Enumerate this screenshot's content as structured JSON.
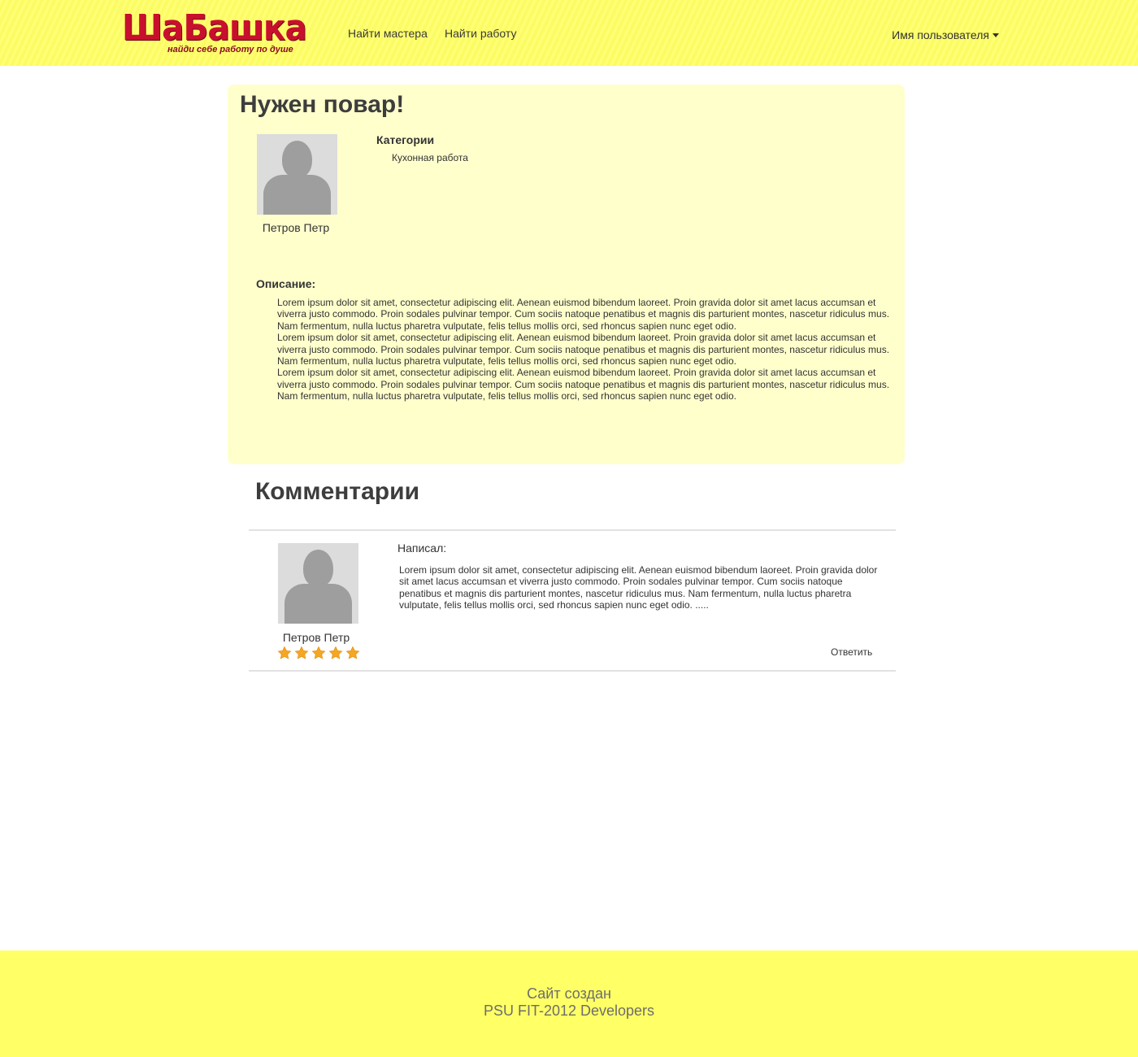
{
  "header": {
    "logo_text": "ШаБашка",
    "logo_tagline": "найди себе работу по душе",
    "nav": [
      {
        "label": "Найти мастера"
      },
      {
        "label": "Найти работу"
      }
    ],
    "user_menu_label": "Имя пользователя"
  },
  "job": {
    "title": "Нужен повар!",
    "author": "Петров Петр",
    "categories_title": "Категории",
    "categories": [
      "Кухонная работа"
    ],
    "description_title": "Описание:",
    "description_paragraphs": [
      "Lorem ipsum dolor sit amet, consectetur adipiscing elit. Aenean euismod bibendum laoreet. Proin gravida dolor sit amet lacus accumsan et viverra justo commodo. Proin sodales pulvinar tempor. Cum sociis natoque penatibus et magnis dis parturient montes, nascetur ridiculus mus. Nam fermentum, nulla luctus pharetra vulputate, felis tellus mollis orci, sed rhoncus sapien nunc eget odio.",
      "Lorem ipsum dolor sit amet, consectetur adipiscing elit. Aenean euismod bibendum laoreet. Proin gravida dolor sit amet lacus accumsan et viverra justo commodo. Proin sodales pulvinar tempor. Cum sociis natoque penatibus et magnis dis parturient montes, nascetur ridiculus mus. Nam fermentum, nulla luctus pharetra vulputate, felis tellus mollis orci, sed rhoncus sapien nunc eget odio.",
      "Lorem ipsum dolor sit amet, consectetur adipiscing elit. Aenean euismod bibendum laoreet. Proin gravida dolor sit amet lacus accumsan et viverra justo commodo. Proin sodales pulvinar tempor. Cum sociis natoque penatibus et magnis dis parturient montes, nascetur ridiculus mus. Nam fermentum, nulla luctus pharetra vulputate, felis tellus mollis orci, sed rhoncus sapien nunc eget odio."
    ]
  },
  "comments": {
    "title": "Комментарии",
    "items": [
      {
        "wrote_label": "Написал:",
        "author": "Петров Петр",
        "rating": 5,
        "rating_max": 5,
        "text": "Lorem ipsum dolor sit amet, consectetur adipiscing elit. Aenean euismod bibendum laoreet. Proin gravida dolor sit amet lacus accumsan et viverra justo commodo. Proin sodales pulvinar tempor. Cum sociis natoque penatibus et magnis dis parturient montes, nascetur ridiculus mus. Nam fermentum, nulla luctus pharetra vulputate, felis tellus mollis orci, sed rhoncus sapien nunc eget odio. .....",
        "reply_label": "Ответить"
      }
    ]
  },
  "footer": {
    "line1": "Сайт создан",
    "line2": "PSU FIT-2012 Developers"
  },
  "colors": {
    "header_bg": "#ffff66",
    "card_bg": "#ffffcc",
    "star": "#f5a623",
    "logo_red": "#c8102e"
  }
}
